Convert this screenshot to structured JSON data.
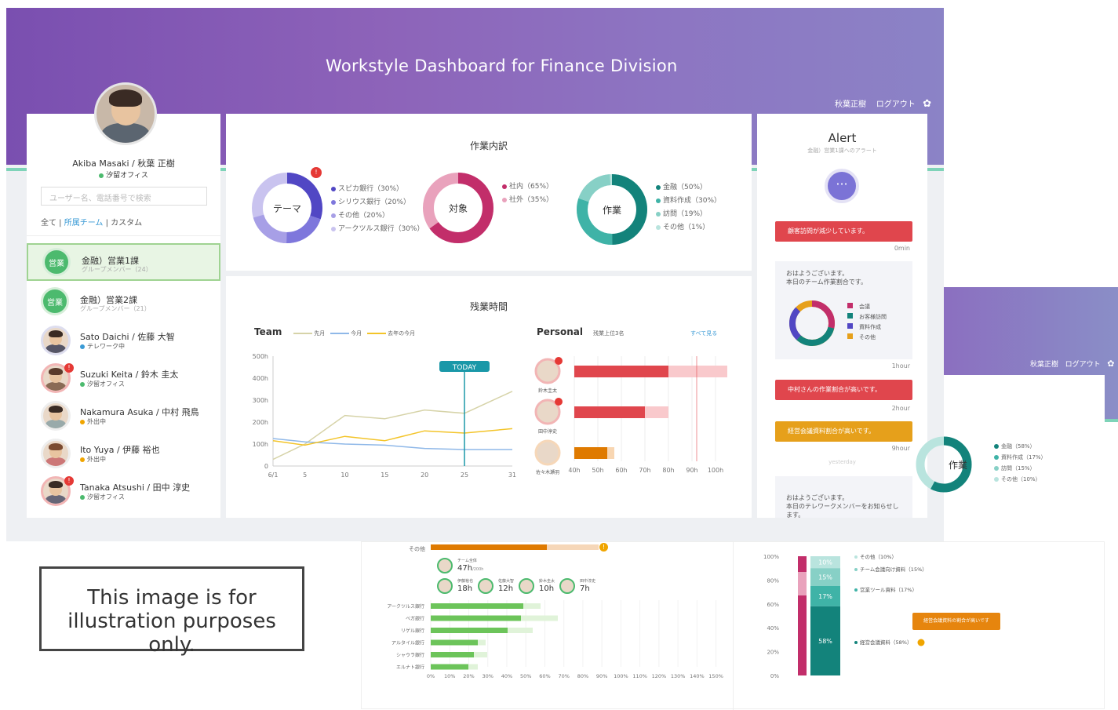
{
  "header": {
    "title": "Workstyle Dashboard for Finance Division",
    "user": "秋葉正樹",
    "logout": "ログアウト"
  },
  "header2": {
    "user": "秋葉正樹",
    "logout": "ログアウト"
  },
  "profile": {
    "name": "Akiba Masaki / 秋葉 正樹",
    "location": "汐留オフィス",
    "search_placeholder": "ユーザー名、電話番号で検索",
    "filter_all": "全て",
    "filter_team": "所属チーム",
    "filter_custom": "カスタム"
  },
  "groups": [
    {
      "badge": "営業",
      "name": "金融）営業1課",
      "sub": "グループメンバー（24）"
    },
    {
      "badge": "営業",
      "name": "金融）営業2課",
      "sub": "グループメンバー（21）"
    }
  ],
  "people": [
    {
      "name": "Sato Daichi / 佐藤 大智",
      "status": "テレワーク中",
      "status_color": "#3b9bd6"
    },
    {
      "name": "Suzuki Keita / 鈴木 圭太",
      "status": "汐留オフィス",
      "status_color": "#4cba6e"
    },
    {
      "name": "Nakamura Asuka / 中村 飛鳥",
      "status": "外出中",
      "status_color": "#f0a500"
    },
    {
      "name": "Ito Yuya / 伊藤 裕也",
      "status": "外出中",
      "status_color": "#f0a500"
    },
    {
      "name": "Tanaka Atsushi / 田中 淳史",
      "status": "汐留オフィス",
      "status_color": "#4cba6e"
    }
  ],
  "work": {
    "title": "作業内訳",
    "donuts": [
      {
        "label": "テーマ",
        "legend": [
          "スピカ銀行（30%）",
          "シリウス銀行（20%）",
          "その他（20%）",
          "アークツルス銀行（30%）"
        ]
      },
      {
        "label": "対象",
        "legend": [
          "社内（65%）",
          "社外（35%）"
        ]
      },
      {
        "label": "作業",
        "legend": [
          "金融（50%）",
          "資料作成（30%）",
          "訪問（19%）",
          "その他（1%）"
        ]
      }
    ]
  },
  "overtime": {
    "title": "残業時間",
    "team_label": "Team",
    "legend": [
      "先月",
      "今月",
      "去年の今月"
    ],
    "today": "TODAY",
    "personal_label": "Personal",
    "personal_sub": "残業上位3名",
    "see_all": "すべて見る",
    "persons": [
      "鈴木圭太",
      "田中淳史",
      "佐々木瀬羽"
    ]
  },
  "chart_data": [
    {
      "type": "line",
      "title": "Team",
      "x_ticks": [
        "6/1",
        "5",
        "10",
        "15",
        "20",
        "25",
        "31"
      ],
      "y_ticks": [
        "500h",
        "400h",
        "300h",
        "200h",
        "100h",
        "0"
      ],
      "series": [
        {
          "name": "先月",
          "x": [
            1,
            5,
            10,
            15,
            20,
            25,
            31
          ],
          "values": [
            30,
            100,
            230,
            215,
            255,
            240,
            340
          ]
        },
        {
          "name": "今月",
          "x": [
            1,
            5,
            10,
            15,
            20,
            25,
            31
          ],
          "values": [
            125,
            110,
            100,
            95,
            80,
            75,
            75
          ]
        },
        {
          "name": "去年の今月",
          "x": [
            1,
            5,
            10,
            15,
            20,
            25,
            31
          ],
          "values": [
            115,
            95,
            135,
            115,
            160,
            150,
            170
          ]
        }
      ],
      "ylim": [
        0,
        500
      ]
    },
    {
      "type": "bar",
      "title": "Personal",
      "categories": [
        "鈴木圭太",
        "田中淳史",
        "佐々木瀬羽"
      ],
      "x_ticks": [
        "40h",
        "50h",
        "60h",
        "70h",
        "80h",
        "90h",
        "100h"
      ],
      "values": [
        80,
        70,
        54
      ],
      "extra": [
        105,
        80,
        57
      ]
    }
  ],
  "alert": {
    "title": "Alert",
    "subtitle": "金融）営業1課へのアラート",
    "items": [
      {
        "text": "顧客訪問が減少しています。",
        "time": "0min",
        "color": "#e0464d"
      },
      {
        "text": "中村さんの作業割合が高いです。",
        "time": "2hour",
        "color": "#e0464d"
      },
      {
        "text": "経営会議資料割合が高いです。",
        "time": "9hour",
        "color": "#e6a01b"
      }
    ],
    "msg1_line1": "おはようございます。",
    "msg1_line2": "本日のチーム作業割合です。",
    "msg1_legend": [
      "会議",
      "お客様訪問",
      "資料作成",
      "その他"
    ],
    "msg1_time": "1hour",
    "yesterday": "yesterday",
    "msg2_line1": "おはようございます。",
    "msg2_line2": "本日のテレワークメンバーをお知らせします。"
  },
  "side_donut": {
    "label": "作業",
    "legend": [
      "金融（58%）",
      "資料作成（17%）",
      "訪問（15%）",
      "その他（10%）"
    ]
  },
  "bottom_bars": {
    "top_label": "その他",
    "team_total_label": "チーム全体",
    "team_total": "47h",
    "team_total_sub": "/200h",
    "members": [
      {
        "name": "伊藤裕也",
        "hours": "18h"
      },
      {
        "name": "佐藤大智",
        "hours": "12h"
      },
      {
        "name": "鈴木圭太",
        "hours": "10h"
      },
      {
        "name": "田中淳史",
        "hours": "7h"
      }
    ],
    "rows": [
      "アークツルス銀行",
      "ベガ銀行",
      "リゲル銀行",
      "アルタイル銀行",
      "シャウラ銀行",
      "エルナト銀行"
    ],
    "x_ticks": [
      "0%",
      "10%",
      "20%",
      "30%",
      "40%",
      "50%",
      "60%",
      "70%",
      "80%",
      "90%",
      "100%",
      "110%",
      "120%",
      "130%",
      "140%",
      "150%"
    ]
  },
  "stack": {
    "y_ticks": [
      "100%",
      "80%",
      "60%",
      "40%",
      "20%",
      "0%"
    ],
    "segments": [
      "10%",
      "15%",
      "17%",
      "58%"
    ],
    "legend": [
      "その他（10%）",
      "チーム会議向け資料（15%）",
      "営業ツール資料（17%）",
      "経営会議資料（58%）"
    ],
    "callout": "経営会議資料の割合が高いです"
  },
  "notice": {
    "line1": "This image is for",
    "line2": "illustration purposes only."
  }
}
